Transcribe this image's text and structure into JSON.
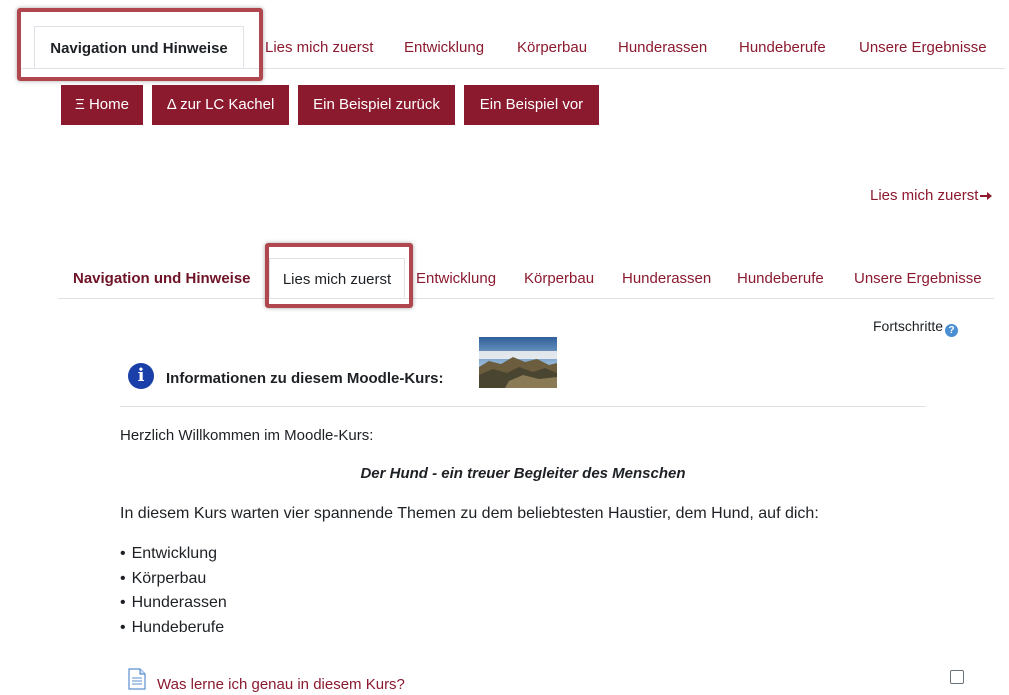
{
  "top_tabs": [
    {
      "label": "Navigation und Hinweise",
      "active": true
    },
    {
      "label": "Lies mich zuerst"
    },
    {
      "label": "Entwicklung"
    },
    {
      "label": "Körperbau"
    },
    {
      "label": "Hunderassen"
    },
    {
      "label": "Hundeberufe"
    },
    {
      "label": "Unsere Ergebnisse"
    }
  ],
  "buttons": {
    "home": "Ξ Home",
    "lc_kachel": "Δ zur LC Kachel",
    "prev": "Ein Beispiel zurück",
    "next": "Ein Beispiel vor"
  },
  "next_section_link": "Lies mich zuerst",
  "section_tabs": [
    {
      "label": "Navigation und Hinweise"
    },
    {
      "label": "Lies mich zuerst",
      "active": true
    },
    {
      "label": "Entwicklung"
    },
    {
      "label": "Körperbau"
    },
    {
      "label": "Hunderassen"
    },
    {
      "label": "Hundeberufe"
    },
    {
      "label": "Unsere Ergebnisse"
    }
  ],
  "progress_label": "Fortschritte",
  "info": {
    "title": "Informationen zu diesem Moodle-Kurs:"
  },
  "content": {
    "welcome": "Herzlich Willkommen im Moodle-Kurs:",
    "course_title": "Der Hund - ein treuer Begleiter des Menschen",
    "intro": "In diesem Kurs warten vier spannende Themen zu dem beliebtesten Haustier, dem Hund, auf dich:",
    "topics": [
      "Entwicklung",
      "Körperbau",
      "Hunderassen",
      "Hundeberufe"
    ]
  },
  "activity": {
    "label": "Was lerne ich genau in diesem Kurs?",
    "completed": false
  },
  "colors": {
    "brand": "#8b1a2f",
    "highlight": "#b0474f"
  }
}
